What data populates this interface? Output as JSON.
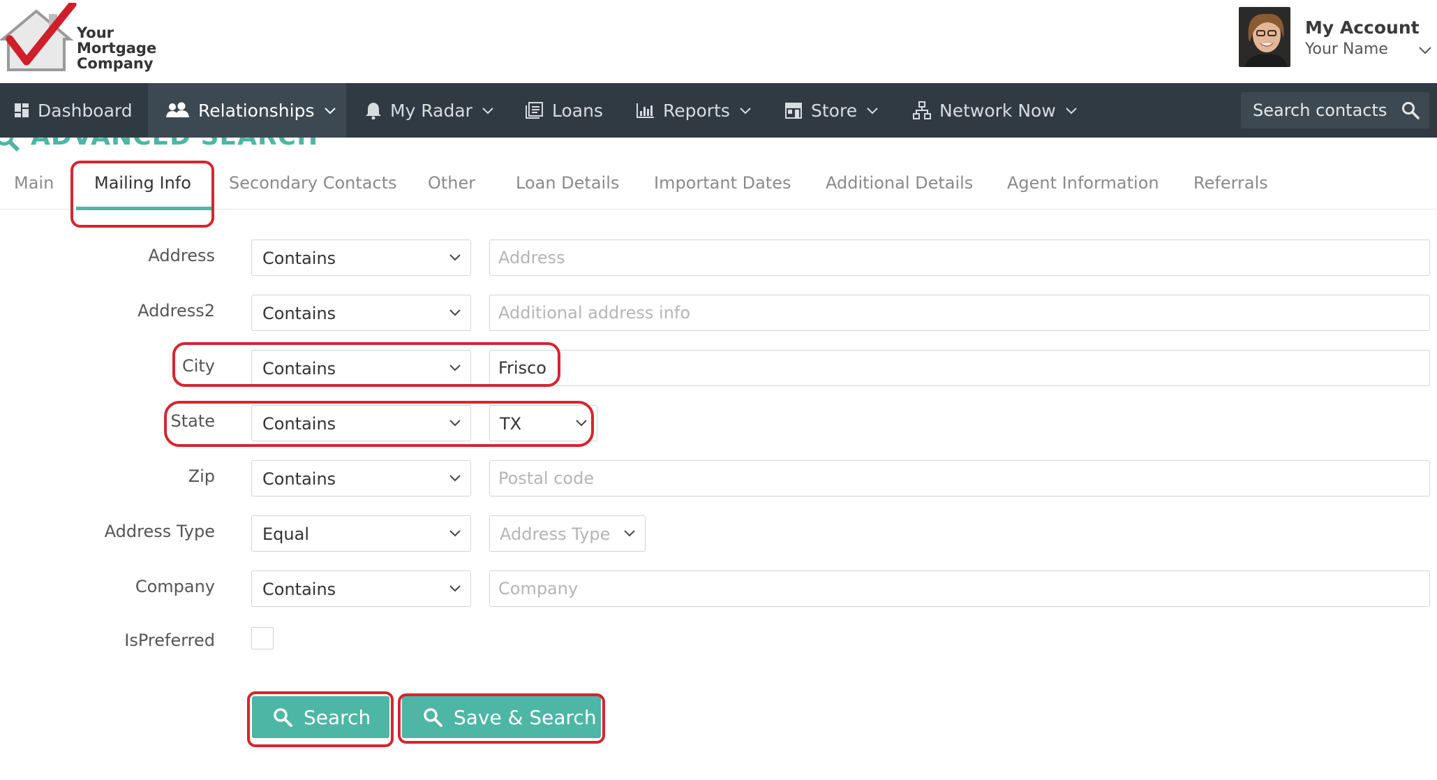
{
  "brand": {
    "logo_lines": [
      "Your",
      "Mortgage",
      "Company"
    ],
    "accent_color": "#4db6a4",
    "nav_bg": "#2f3a43",
    "annotation_color": "#d6252f"
  },
  "account": {
    "title": "My Account",
    "name": "Your Name"
  },
  "nav": {
    "items": [
      {
        "label": "Dashboard",
        "icon": "dashboard-icon"
      },
      {
        "label": "Relationships",
        "icon": "people-icon",
        "active": true
      },
      {
        "label": "My Radar",
        "icon": "bell-icon"
      },
      {
        "label": "Loans",
        "icon": "loans-icon"
      },
      {
        "label": "Reports",
        "icon": "chart-icon"
      },
      {
        "label": "Store",
        "icon": "store-icon"
      },
      {
        "label": "Network Now",
        "icon": "network-icon"
      }
    ],
    "search_placeholder": "Search contacts"
  },
  "page": {
    "title": "ADVANCED SEARCH"
  },
  "tabs": [
    "Main",
    "Mailing Info",
    "Secondary Contacts",
    "Other",
    "Loan Details",
    "Important Dates",
    "Additional Details",
    "Agent Information",
    "Referrals"
  ],
  "active_tab": "Mailing Info",
  "form": {
    "address": {
      "label": "Address",
      "operator": "Contains",
      "placeholder": "Address",
      "value": ""
    },
    "address2": {
      "label": "Address2",
      "operator": "Contains",
      "placeholder": "Additional address info",
      "value": ""
    },
    "city": {
      "label": "City",
      "operator": "Contains",
      "placeholder": "",
      "value": "Frisco"
    },
    "state": {
      "label": "State",
      "operator": "Contains",
      "value": "TX"
    },
    "zip": {
      "label": "Zip",
      "operator": "Contains",
      "placeholder": "Postal code",
      "value": ""
    },
    "address_type": {
      "label": "Address Type",
      "operator": "Equal",
      "placeholder": "Address Type"
    },
    "company": {
      "label": "Company",
      "operator": "Contains",
      "placeholder": "Company",
      "value": ""
    },
    "is_preferred": {
      "label": "IsPreferred",
      "checked": false
    }
  },
  "buttons": {
    "search": "Search",
    "save_search": "Save & Search"
  }
}
